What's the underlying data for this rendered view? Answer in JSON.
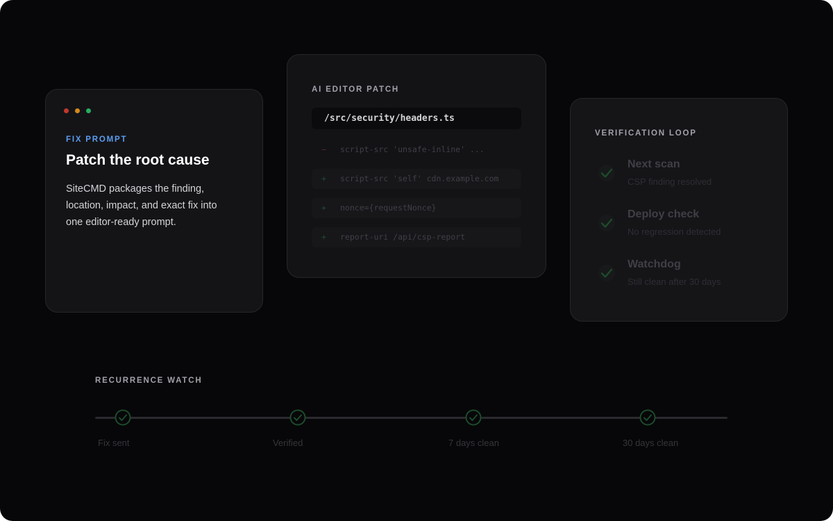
{
  "fix_card": {
    "dots": [
      "#c0392b",
      "#d48a1a",
      "#27ae60"
    ],
    "eyebrow": "FIX PROMPT",
    "title": "Patch the root cause",
    "body": "SiteCMD packages the finding, location, impact, and exact fix into one editor-ready prompt."
  },
  "patch_card": {
    "eyebrow": "AI EDITOR PATCH",
    "file_path": "/src/security/headers.ts",
    "lines": [
      {
        "sign": "−",
        "type": "del",
        "text": "script-src 'unsafe-inline' ..."
      },
      {
        "sign": "+",
        "type": "add",
        "text": "script-src 'self' cdn.example.com"
      },
      {
        "sign": "+",
        "type": "add",
        "text": "nonce={requestNonce}"
      },
      {
        "sign": "+",
        "type": "add",
        "text": "report-uri /api/csp-report"
      }
    ]
  },
  "verify_card": {
    "eyebrow": "VERIFICATION LOOP",
    "items": [
      {
        "title": "Next scan",
        "subtitle": "CSP finding resolved",
        "icon": "check-icon"
      },
      {
        "title": "Deploy check",
        "subtitle": "No regression detected",
        "icon": "check-icon"
      },
      {
        "title": "Watchdog",
        "subtitle": "Still clean after 30 days",
        "icon": "check-icon"
      }
    ]
  },
  "recurrence": {
    "eyebrow": "RECURRENCE WATCH",
    "steps": [
      {
        "label": "Fix sent",
        "icon": "check-circle-icon"
      },
      {
        "label": "Verified",
        "icon": "check-circle-icon"
      },
      {
        "label": "7 days clean",
        "icon": "check-circle-icon"
      },
      {
        "label": "30 days clean",
        "icon": "check-circle-icon"
      }
    ]
  },
  "colors": {
    "accent": "#5b9cf0",
    "check_dim": "#1e4a2c",
    "background": "#070709",
    "card": "#141417"
  }
}
